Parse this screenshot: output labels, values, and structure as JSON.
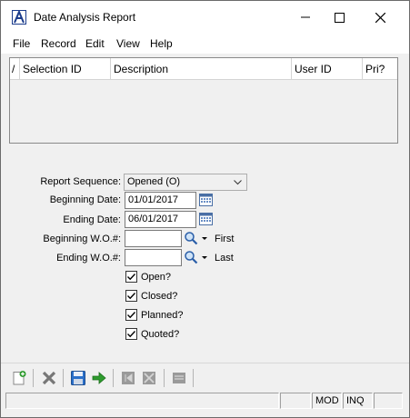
{
  "window": {
    "title": "Date Analysis Report"
  },
  "menu": [
    "File",
    "Record",
    "Edit",
    "View",
    "Help"
  ],
  "grid": {
    "columns": [
      "/",
      "Selection ID",
      "Description",
      "User ID",
      "Pri?"
    ]
  },
  "form": {
    "report_sequence_label": "Report Sequence:",
    "report_sequence_value": "Opened (O)",
    "beginning_date_label": "Beginning Date:",
    "beginning_date_value": "01/01/2017",
    "ending_date_label": "Ending Date:",
    "ending_date_value": "06/01/2017",
    "beginning_wo_label": "Beginning W.O.#:",
    "beginning_wo_value": "",
    "beginning_wo_link": "First",
    "ending_wo_label": "Ending W.O.#:",
    "ending_wo_value": "",
    "ending_wo_link": "Last",
    "checks": [
      {
        "label": "Open?",
        "checked": true
      },
      {
        "label": "Closed?",
        "checked": true
      },
      {
        "label": "Planned?",
        "checked": true
      },
      {
        "label": "Quoted?",
        "checked": true
      }
    ]
  },
  "toolbar": {
    "icons": [
      "new-icon",
      "delete-icon",
      "save-icon",
      "go-icon",
      "first-icon",
      "expand-icon",
      "list-icon"
    ]
  },
  "statusbar": {
    "cells": [
      "",
      "",
      "MOD",
      "INQ",
      ""
    ]
  },
  "colors": {
    "app_icon": "#1b3c8c",
    "go_arrow": "#2e9b2e",
    "save_blue": "#2a6fc9"
  }
}
